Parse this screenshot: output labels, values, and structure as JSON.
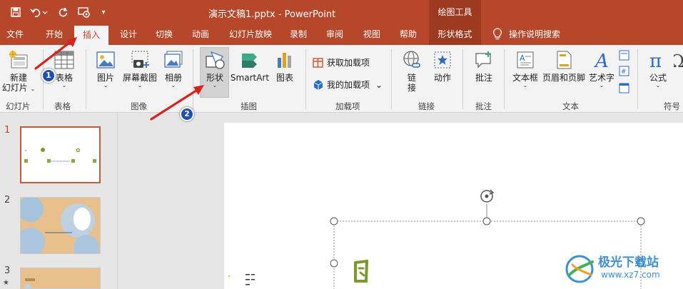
{
  "window": {
    "title": "演示文稿1.pptx - PowerPoint",
    "context_header": "绘图工具"
  },
  "tabs": [
    {
      "label": "文件"
    },
    {
      "label": "开始"
    },
    {
      "label": "插入"
    },
    {
      "label": "设计"
    },
    {
      "label": "切换"
    },
    {
      "label": "动画"
    },
    {
      "label": "幻灯片放映"
    },
    {
      "label": "录制"
    },
    {
      "label": "审阅"
    },
    {
      "label": "视图"
    },
    {
      "label": "帮助"
    },
    {
      "label": "形状格式"
    }
  ],
  "active_tab": "插入",
  "tell_me": "操作说明搜索",
  "ribbon": {
    "new_slide": {
      "line1": "新建",
      "line2": "幻灯片"
    },
    "table": "表格",
    "picture": "图片",
    "screenshot": "屏幕截图",
    "album": "相册",
    "shapes": "形状",
    "smartart": "SmartArt",
    "chart": "图表",
    "get_addins": "获取加载项",
    "my_addins": "我的加载项",
    "link": {
      "line1": "链",
      "line2": "接"
    },
    "action": "动作",
    "comment": "批注",
    "textbox": "文本框",
    "header_footer": "页眉和页脚",
    "wordart": "艺术字",
    "equation": "公式",
    "groups": {
      "slides": "幻灯片",
      "tables": "表格",
      "images": "图像",
      "illustrations": "插图",
      "addins": "加载项",
      "links": "链接",
      "comments": "批注",
      "text": "文本",
      "symbols": "符号"
    }
  },
  "slides": [
    {
      "number": "1",
      "selected": true
    },
    {
      "number": "2",
      "selected": false
    },
    {
      "number": "3",
      "selected": false
    }
  ],
  "callouts": [
    "1",
    "2"
  ],
  "watermark": {
    "text": "极光下载站",
    "url": "www.xz7.com"
  },
  "colors": {
    "accent": "#b7472a",
    "context_tab": "#9d3a20",
    "callout": "#1f4fb0",
    "arrow": "#d8231c"
  }
}
